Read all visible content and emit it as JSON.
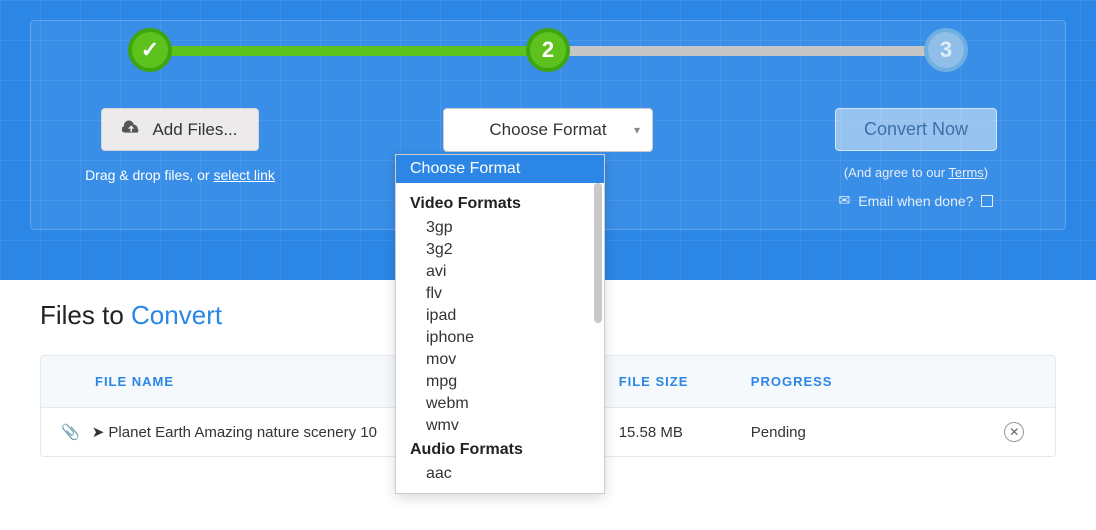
{
  "stepper": {
    "step1": "✓",
    "step2": "2",
    "step3": "3"
  },
  "add_files": {
    "button_label": "Add Files...",
    "drag_text_prefix": "Drag & drop files, or ",
    "drag_link": "select link"
  },
  "format": {
    "select_label": "Choose Format",
    "dropdown_selected": "Choose Format",
    "group_video": "Video Formats",
    "video_items": [
      "3gp",
      "3g2",
      "avi",
      "flv",
      "ipad",
      "iphone",
      "mov",
      "mpg",
      "webm",
      "wmv"
    ],
    "group_audio": "Audio Formats",
    "audio_items": [
      "aac"
    ]
  },
  "convert": {
    "button_label": "Convert Now",
    "agree_prefix": "(And agree to our ",
    "agree_link": "Terms",
    "agree_suffix": ")",
    "email_label": "Email when done?"
  },
  "files": {
    "title_prefix": "Files to ",
    "title_accent": "Convert",
    "col_name": "FILE NAME",
    "col_size": "FILE SIZE",
    "col_progress": "PROGRESS",
    "rows": [
      {
        "name": "➤ Planet Earth Amazing nature scenery 10",
        "size": "15.58 MB",
        "progress": "Pending"
      }
    ]
  }
}
